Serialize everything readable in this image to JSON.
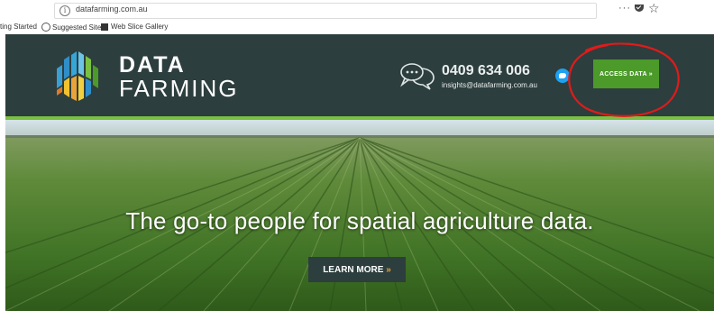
{
  "browser": {
    "url": "datafarming.com.au",
    "info_glyph": "i",
    "more_glyph": "···",
    "star_glyph": "☆",
    "bookmarks": [
      {
        "label": "ting Started",
        "icon": ""
      },
      {
        "label": "Suggested Sites",
        "icon": "globe-icon"
      },
      {
        "label": "Web Slice Gallery",
        "icon": "web-slice-icon"
      }
    ]
  },
  "header": {
    "logo_line1": "DATA",
    "logo_line2": "FARMING",
    "phone": "0409 634 006",
    "email": "insights@datafarming.com.au",
    "access_button": "ACCESS DATA »",
    "background_color": "#2d3e3e",
    "accent_color": "#7ac142",
    "button_color": "#4c9a2a"
  },
  "hero": {
    "tagline": "The go-to people for spatial agriculture data.",
    "cta_label": "LEARN MORE",
    "cta_arrow": "»",
    "cta_arrow_color": "#e8a33a"
  },
  "annotation": {
    "color": "#e01b1b",
    "target": "access-data-button"
  }
}
